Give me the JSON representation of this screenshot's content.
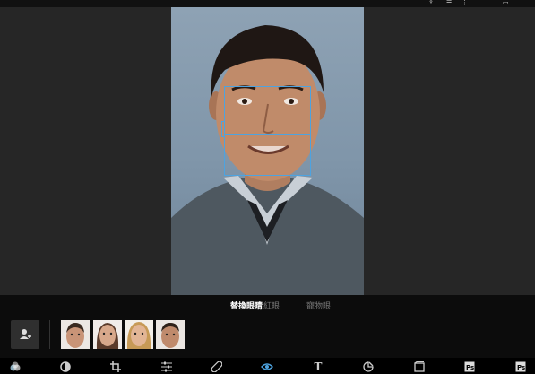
{
  "topbar": {
    "icons": [
      "share-icon",
      "menu-icon",
      "more-icon",
      "window-icon"
    ]
  },
  "modes": [
    {
      "label": "替換眼睛",
      "active": true
    },
    {
      "label": "紅眼",
      "active": false
    },
    {
      "label": "寵物眼",
      "active": false
    }
  ],
  "tray": {
    "add_icon": "add-eye-icon",
    "thumbnails": [
      "eye-source-man",
      "eye-source-woman-1",
      "eye-source-woman-2",
      "eye-source-man-2"
    ]
  },
  "toolbar": {
    "text_tool_label": "T",
    "tools": [
      "looks-icon",
      "auto-fix-icon",
      "crop-icon",
      "adjustments-icon",
      "healing-icon",
      "eye-icon",
      "text-icon",
      "sticker-icon",
      "frame-icon",
      "photoshop-icon",
      "photoshop-express-icon"
    ]
  },
  "colors": {
    "accent": "#4da3e0",
    "background": "#262626",
    "tray": "#0c0c0c"
  }
}
